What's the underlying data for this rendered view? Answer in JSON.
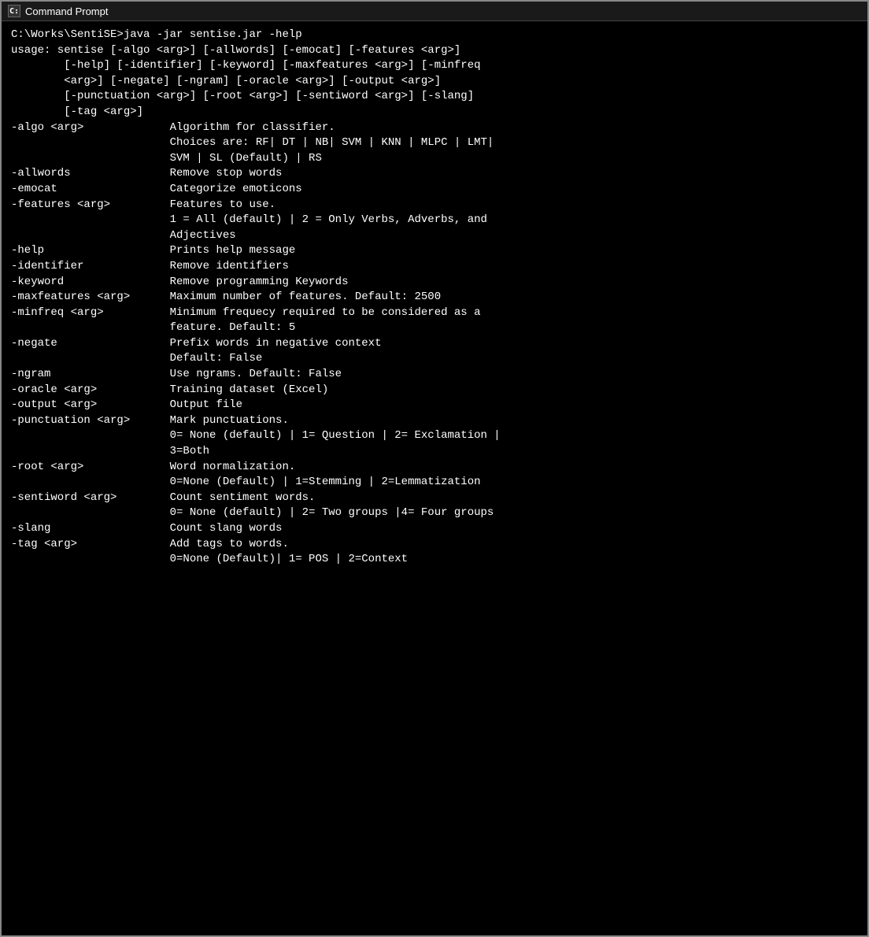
{
  "window": {
    "title": "Command Prompt",
    "title_icon": "C:\\",
    "background": "#000000",
    "foreground": "#ffffff"
  },
  "content": {
    "lines": [
      "C:\\Works\\SentiSE>java -jar sentise.jar -help",
      "usage: sentise [-algo <arg>] [-allwords] [-emocat] [-features <arg>]",
      "        [-help] [-identifier] [-keyword] [-maxfeatures <arg>] [-minfreq",
      "        <arg>] [-negate] [-ngram] [-oracle <arg>] [-output <arg>]",
      "        [-punctuation <arg>] [-root <arg>] [-sentiword <arg>] [-slang]",
      "        [-tag <arg>]",
      "-algo <arg>             Algorithm for classifier.",
      "                        Choices are: RF| DT | NB| SVM | KNN | MLPC | LMT|",
      "                        SVM | SL (Default) | RS",
      "-allwords               Remove stop words",
      "-emocat                 Categorize emoticons",
      "-features <arg>         Features to use.",
      "                        1 = All (default) | 2 = Only Verbs, Adverbs, and",
      "                        Adjectives",
      "-help                   Prints help message",
      "-identifier             Remove identifiers",
      "-keyword                Remove programming Keywords",
      "-maxfeatures <arg>      Maximum number of features. Default: 2500",
      "-minfreq <arg>          Minimum frequecy required to be considered as a",
      "                        feature. Default: 5",
      "-negate                 Prefix words in negative context",
      "                        Default: False",
      "-ngram                  Use ngrams. Default: False",
      "-oracle <arg>           Training dataset (Excel)",
      "-output <arg>           Output file",
      "-punctuation <arg>      Mark punctuations.",
      "                        0= None (default) | 1= Question | 2= Exclamation |",
      "                        3=Both",
      "-root <arg>             Word normalization.",
      "                        0=None (Default) | 1=Stemming | 2=Lemmatization",
      "-sentiword <arg>        Count sentiment words.",
      "                        0= None (default) | 2= Two groups |4= Four groups",
      "-slang                  Count slang words",
      "-tag <arg>              Add tags to words.",
      "                        0=None (Default)| 1= POS | 2=Context"
    ]
  }
}
